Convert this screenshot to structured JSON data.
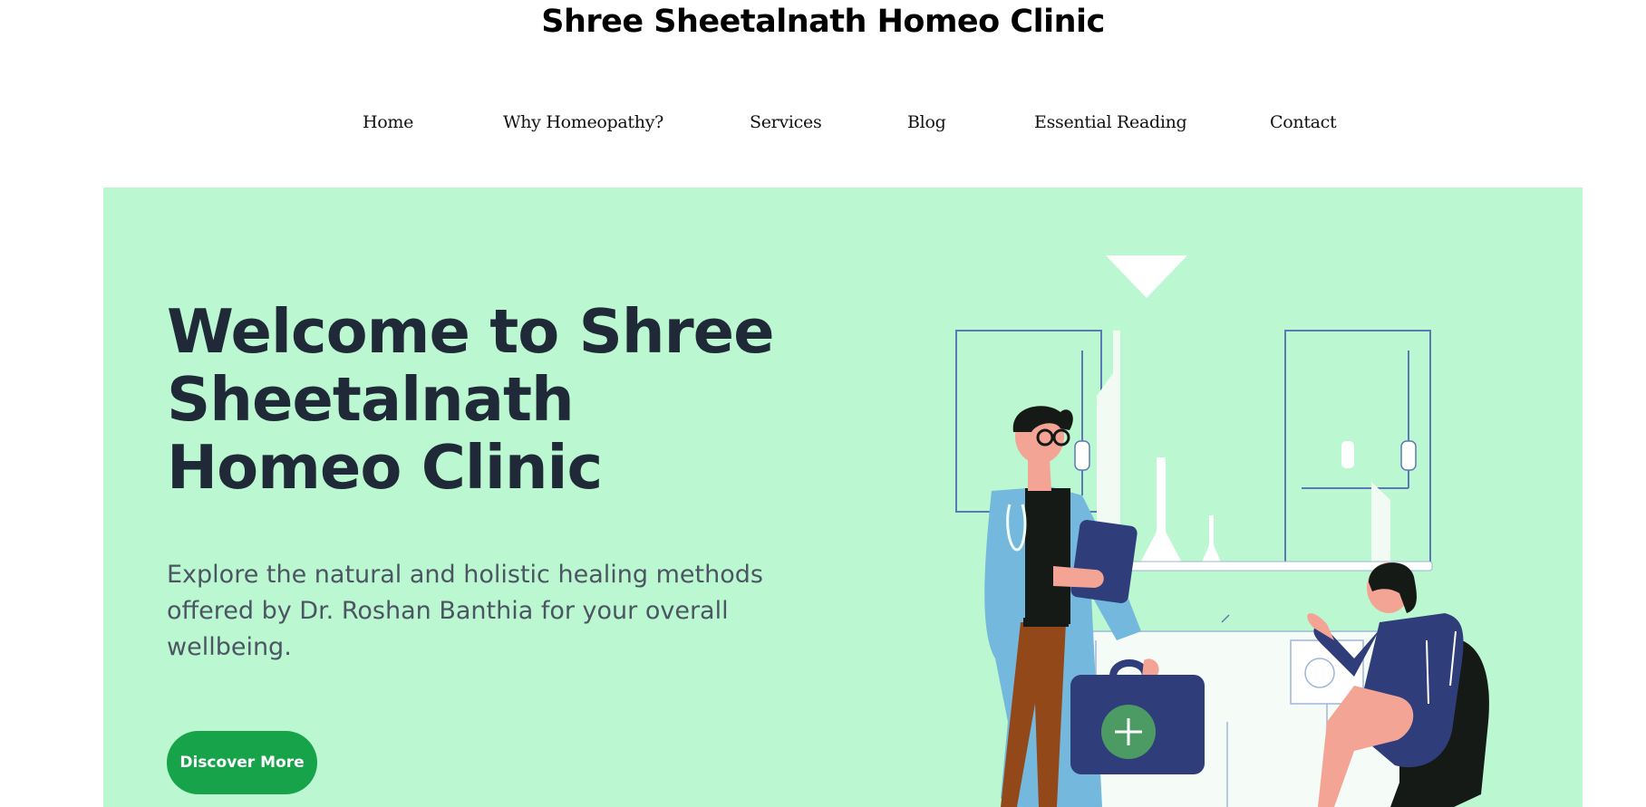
{
  "site": {
    "title": "Shree Sheetalnath Homeo Clinic"
  },
  "nav": {
    "items": [
      {
        "label": "Home"
      },
      {
        "label": "Why Homeopathy?"
      },
      {
        "label": "Services"
      },
      {
        "label": "Blog"
      },
      {
        "label": "Essential Reading"
      },
      {
        "label": "Contact"
      }
    ]
  },
  "hero": {
    "title": "Welcome to Shree Sheetalnath Homeo Clinic",
    "description": "Explore the natural and holistic healing methods offered by Dr. Roshan Banthia for your overall wellbeing.",
    "cta_label": "Discover More",
    "illustration_icon": "doctor-patient-consultation-illustration"
  },
  "colors": {
    "hero_background": "#bbf7d0",
    "heading": "#1f2937",
    "body_text": "#4b5563",
    "cta_background": "#16a34a",
    "cta_text": "#ffffff"
  }
}
